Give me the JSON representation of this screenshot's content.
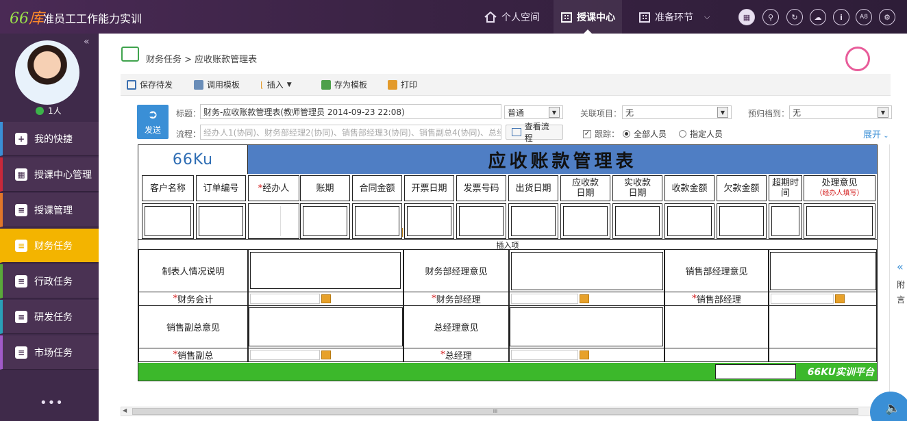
{
  "app": {
    "logo_num": "66",
    "logo_char": "库",
    "title": "准员工工作能力实训"
  },
  "topnav": [
    {
      "label": "个人空间"
    },
    {
      "label": "授课中心"
    },
    {
      "label": "准备环节"
    }
  ],
  "top_icons": [
    "grid-icon",
    "search-icon",
    "refresh-icon",
    "cloud-icon",
    "info-icon",
    "A8",
    "settings-icon"
  ],
  "top_icon_text": {
    "a8": "A8"
  },
  "sidebar": {
    "online_count": "1人",
    "more": "•••",
    "items": [
      {
        "label": "我的快捷",
        "color": "#3a8fd6"
      },
      {
        "label": "授课中心管理",
        "color": "#c8283a"
      },
      {
        "label": "授课管理",
        "color": "#e0762a"
      },
      {
        "label": "财务任务",
        "color": "#f3b400"
      },
      {
        "label": "行政任务",
        "color": "#5aa83a"
      },
      {
        "label": "研发任务",
        "color": "#2a9fb8"
      },
      {
        "label": "市场任务",
        "color": "#a05ac8"
      }
    ]
  },
  "breadcrumb": "财务任务 > 应收账款管理表",
  "toolbar": [
    {
      "label": "保存待发"
    },
    {
      "label": "调用模板"
    },
    {
      "label": "插入"
    },
    {
      "label": "存为模板"
    },
    {
      "label": "打印"
    }
  ],
  "form": {
    "send_label": "发送",
    "title_label": "标题：",
    "title_value": "财务-应收账款管理表(教师管理员 2014-09-23 22:08)",
    "priority": "普通",
    "related_label": "关联项目：",
    "related_value": "无",
    "archive_label": "预归档到：",
    "archive_value": "无",
    "flow_label": "流程：",
    "flow_placeholder": "经办人1(协同)、财务部经理2(协同)、销售部经理3(协同)、销售副总4(协同)、总经",
    "view_flow": "查看流程",
    "track_label": "跟踪：",
    "track_all": "全部人员",
    "track_specific": "指定人员",
    "expand": "展开"
  },
  "doc": {
    "logo": "66Ku",
    "title": "应收账款管理表",
    "columns": [
      {
        "text": "客户名称"
      },
      {
        "text": "订单编号"
      },
      {
        "text": "经办人",
        "required": true
      },
      {
        "text": "账期"
      },
      {
        "text": "合同金额"
      },
      {
        "text": "开票日期"
      },
      {
        "text": "发票号码"
      },
      {
        "text": "出货日期"
      },
      {
        "text": "应收款日期"
      },
      {
        "text": "实收款日期"
      },
      {
        "text": "收款金额"
      },
      {
        "text": "欠款金额"
      },
      {
        "text": "超期时间"
      },
      {
        "text": "处理意见"
      }
    ],
    "col_labels": {
      "c0": "客户名称",
      "c1": "订单编号",
      "c2": "经办人",
      "c3": "账期",
      "c4": "合同金额",
      "c5": "开票日期",
      "c6": "发票号码",
      "c7": "出货日期",
      "c8a": "应收款",
      "c8b": "日期",
      "c9a": "实收款",
      "c9b": "日期",
      "c10": "收款金额",
      "c11": "欠款金额",
      "c12a": "超期时",
      "c12b": "间",
      "c13": "处理意见",
      "c13sub": "（经办人填写）"
    },
    "insert_row": "插入项",
    "labels": {
      "preparer_note": "制表人情况说明",
      "finance_mgr_opinion": "财务部经理意见",
      "sales_mgr_opinion": "销售部经理意见",
      "accountant": "财务会计",
      "finance_mgr": "财务部经理",
      "sales_mgr": "销售部经理",
      "vp_sales_opinion": "销售副总意见",
      "gm_opinion": "总经理意见",
      "vp_sales": "销售副总",
      "gm": "总经理",
      "star": "*"
    },
    "footer_brand": "66KU实训平台"
  },
  "right_panel": {
    "arrow": "«",
    "text": "附言"
  },
  "scroll_thumb": "III"
}
